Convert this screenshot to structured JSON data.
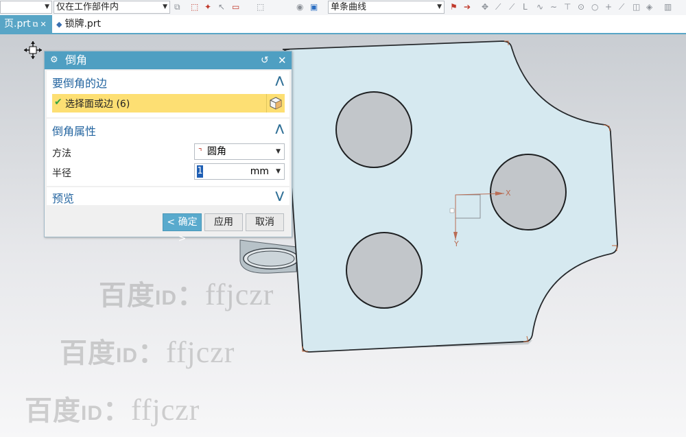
{
  "toolbar": {
    "filter_value": "仅在工作部件内",
    "curve_rule": "单条曲线"
  },
  "tabs": [
    {
      "label": "页.prt"
    },
    {
      "label": "锁牌.prt"
    }
  ],
  "dialog": {
    "title": "倒角",
    "sections": {
      "edges": {
        "header": "要倒角的边",
        "select_label": "选择面或边 (6)"
      },
      "props": {
        "header": "倒角属性",
        "method_label": "方法",
        "method_value": "圆角",
        "radius_label": "半径",
        "radius_value": "1",
        "radius_unit": "mm"
      },
      "preview": {
        "header": "预览"
      }
    },
    "buttons": {
      "ok": "确定",
      "apply": "应用",
      "cancel": "取消"
    }
  },
  "viewport": {
    "axis_x": "X",
    "axis_y": "Y",
    "watermark_prefix": "百度",
    "watermark_id": "ID",
    "watermark_colon": "：",
    "watermark_handle": "ffjczr"
  },
  "colors": {
    "part_face": "#d6e9f0",
    "title_bar": "#4f9fc2",
    "selection_highlight": "#fddf73"
  }
}
